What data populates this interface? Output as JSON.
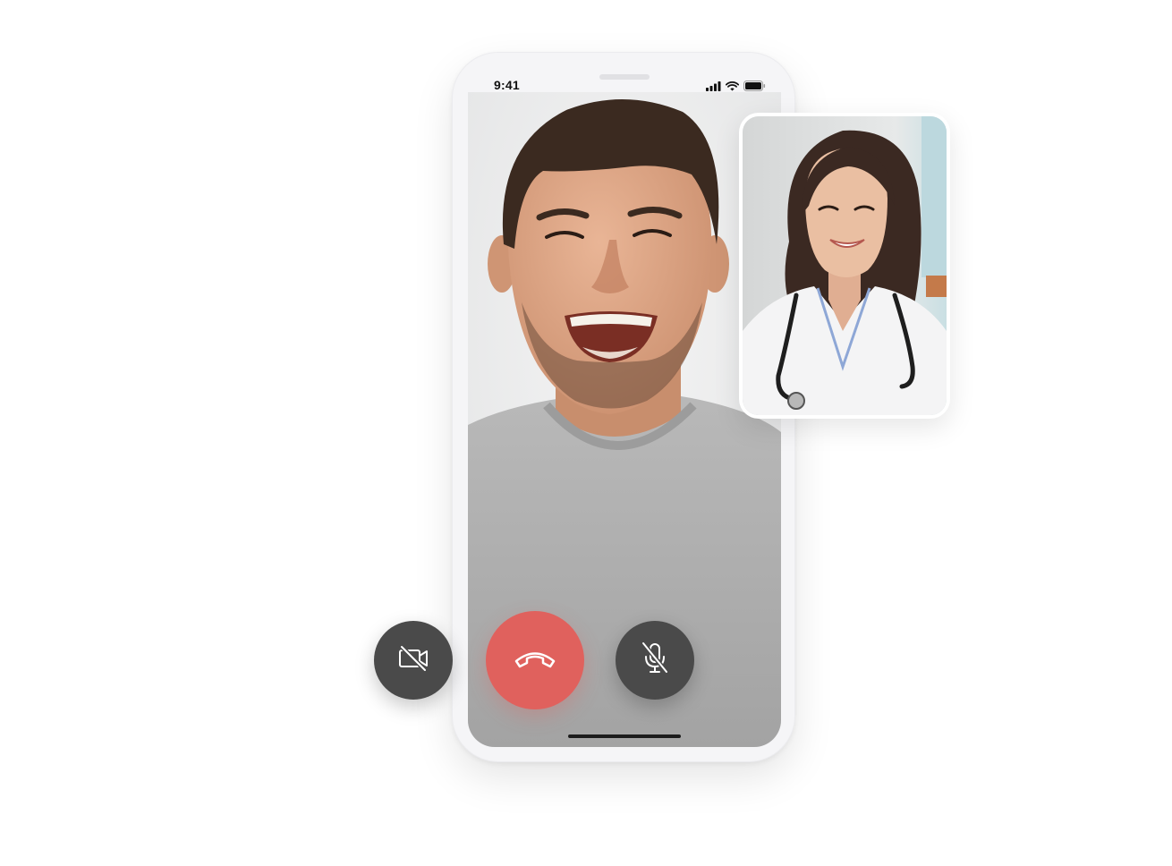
{
  "status_bar": {
    "time": "9:41",
    "icons": [
      "signal-icon",
      "wifi-icon",
      "battery-icon"
    ]
  },
  "main_video": {
    "participant": "man-in-grey-tshirt",
    "avatar": "remote-caller-video"
  },
  "pip_video": {
    "participant": "female-doctor",
    "avatar": "doctor-self-view"
  },
  "controls": [
    {
      "name": "camera-off-button",
      "icon": "camera-off-icon",
      "color": "#4a4a4a"
    },
    {
      "name": "end-call-button",
      "icon": "phone-hangup-icon",
      "color": "#e0615d"
    },
    {
      "name": "mic-off-button",
      "icon": "mic-off-icon",
      "color": "#4a4a4a"
    }
  ],
  "colors": {
    "accent_end_call": "#e0615d",
    "control_dark": "#4a4a4a",
    "phone_frame": "#f5f5f7"
  }
}
